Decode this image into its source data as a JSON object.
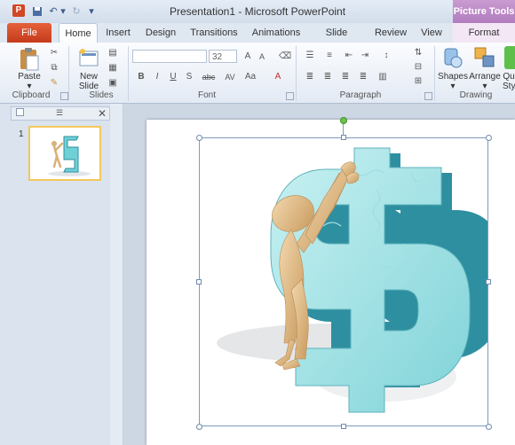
{
  "window": {
    "title": "Presentation1 - Microsoft PowerPoint",
    "app_icon": "P"
  },
  "context_tab": {
    "label": "Picture Tools"
  },
  "tabs": [
    "File",
    "Home",
    "Insert",
    "Design",
    "Transitions",
    "Animations",
    "Slide Show",
    "Review",
    "View",
    "Format"
  ],
  "ribbon": {
    "clipboard": {
      "paste": "Paste",
      "group": "Clipboard"
    },
    "slides": {
      "new_slide_1": "New",
      "new_slide_2": "Slide",
      "group": "Slides"
    },
    "font": {
      "font_size": "32",
      "group": "Font"
    },
    "paragraph": {
      "group": "Paragraph"
    },
    "drawing": {
      "shapes": "Shapes",
      "arrange": "Arrange",
      "quick_styles_1": "Qu",
      "quick_styles_2": "Styl",
      "group": "Drawing"
    }
  },
  "pane": {
    "slide_number": "1"
  },
  "colors": {
    "file_tab": "#d24726",
    "context": "#b27cbf",
    "accent": "#2f6fb5"
  }
}
